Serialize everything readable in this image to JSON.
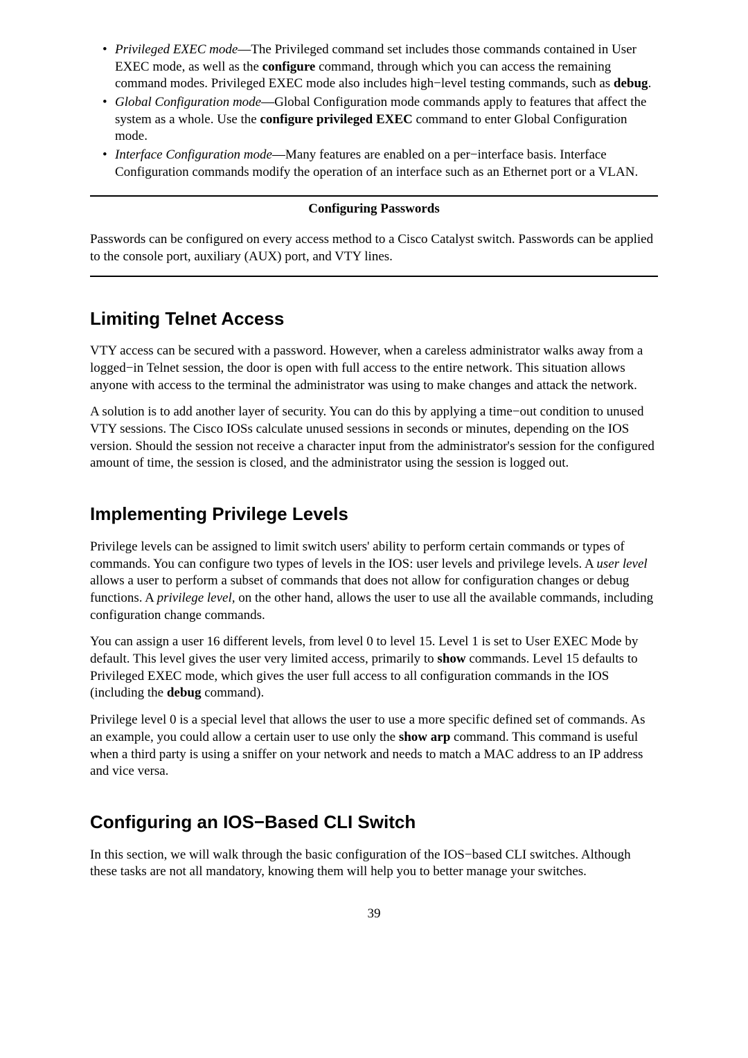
{
  "modes": {
    "privileged": {
      "label": "Privileged EXEC mode",
      "text1": "—The Privileged command set includes those commands contained in User EXEC mode, as well as the ",
      "bold1": "configure",
      "text2": " command, through which you can access the remaining command modes. Privileged EXEC mode also includes high−level testing commands, such as ",
      "bold2": "debug",
      "text3": "."
    },
    "global": {
      "label": "Global Configuration mode",
      "text1": "—Global Configuration mode commands apply to features that affect the system as a whole. Use the ",
      "bold1": "configure privileged EXEC",
      "text2": " command to enter Global Configuration mode."
    },
    "interface": {
      "label": "Interface Configuration mode",
      "text1": "—Many features are enabled on a per−interface basis. Interface Configuration commands modify the operation of an interface such as an Ethernet port or a VLAN."
    }
  },
  "boxHeading": "Configuring Passwords",
  "boxText": "Passwords can be configured on every access method to a Cisco Catalyst switch. Passwords can be applied to the console port, auxiliary (AUX) port, and VTY lines.",
  "section1": {
    "heading": "Limiting Telnet Access",
    "p1": "VTY access can be secured with a password. However, when a careless administrator walks away from a logged−in Telnet session, the door is open with full access to the entire network. This situation allows anyone with access to the terminal the administrator was using to make changes and attack the network.",
    "p2": "A solution is to add another layer of security. You can do this by applying a time−out condition to unused VTY sessions. The Cisco IOSs calculate unused sessions in seconds or minutes, depending on the IOS version. Should the session not receive a character input from the administrator's session for the configured amount of time, the session is closed, and the administrator using the session is logged out."
  },
  "section2": {
    "heading": "Implementing Privilege Levels",
    "p1a": "Privilege levels can be assigned to limit switch users' ability to perform certain commands or types of commands. You can configure two types of levels in the IOS: user levels and privilege levels. A ",
    "p1italic1": "user level",
    "p1b": " allows a user to perform a subset of commands that does not allow for configuration changes or debug functions. A ",
    "p1italic2": "privilege level,",
    "p1c": " on the other hand, allows the user to use all the available commands, including configuration change commands.",
    "p2a": "You can assign a user 16 different levels, from level 0 to level 15. Level 1 is set to User EXEC Mode by default. This level gives the user very limited access, primarily to ",
    "p2bold1": "show",
    "p2b": " commands. Level 15 defaults to Privileged EXEC mode, which gives the user full access to all configuration commands in the IOS (including the ",
    "p2bold2": "debug",
    "p2c": " command).",
    "p3a": "Privilege level 0 is a special level that allows the user to use a more specific defined set of commands. As an example, you could allow a certain user to use only the ",
    "p3bold1": "show arp",
    "p3b": " command. This command is useful when a third party is using a sniffer on your network and needs to match a MAC address to an IP address and vice versa."
  },
  "section3": {
    "heading": "Configuring an IOS−Based CLI Switch",
    "p1": "In this section, we will walk through the basic configuration of the IOS−based CLI switches. Although these tasks are not all mandatory, knowing them will help you to better manage your switches."
  },
  "pageNumber": "39"
}
